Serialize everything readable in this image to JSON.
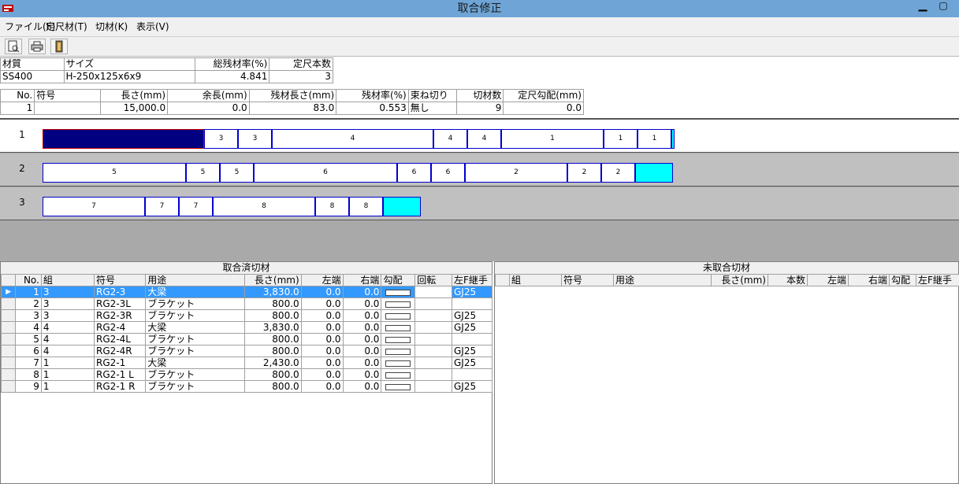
{
  "window": {
    "title": "取合修正"
  },
  "menu": [
    "ファイル(F)",
    "定尺材(T)",
    "切材(K)",
    "表示(V)"
  ],
  "summary": {
    "headers": [
      "材質",
      "サイズ",
      "総残材率(%)",
      "定尺本数"
    ],
    "values": [
      "SS400",
      "H-250x125x6x9",
      "4.841",
      "3"
    ]
  },
  "detail": {
    "headers": [
      "No.",
      "符号",
      "長さ(mm)",
      "余長(mm)",
      "残材長さ(mm)",
      "残材率(%)",
      "束ね切り",
      "切材数",
      "定尺勾配(mm)"
    ],
    "values": [
      "1",
      "",
      "15,000.0",
      "0.0",
      "83.0",
      "0.553",
      "無し",
      "9",
      "0.0"
    ]
  },
  "strips": [
    {
      "label": "1",
      "segments": [
        {
          "text": "",
          "len": 3830,
          "dark": true
        },
        {
          "text": "3",
          "len": 800
        },
        {
          "text": "3",
          "len": 800
        },
        {
          "text": "4",
          "len": 3830
        },
        {
          "text": "4",
          "len": 800
        },
        {
          "text": "4",
          "len": 800
        },
        {
          "text": "1",
          "len": 2430
        },
        {
          "text": "1",
          "len": 800
        },
        {
          "text": "1",
          "len": 800
        }
      ],
      "remainder": 83
    },
    {
      "label": "2",
      "segments": [
        {
          "text": "5",
          "len": 3400
        },
        {
          "text": "5",
          "len": 800
        },
        {
          "text": "5",
          "len": 800
        },
        {
          "text": "6",
          "len": 3400
        },
        {
          "text": "6",
          "len": 800
        },
        {
          "text": "6",
          "len": 800
        },
        {
          "text": "2",
          "len": 2430
        },
        {
          "text": "2",
          "len": 800
        },
        {
          "text": "2",
          "len": 800
        }
      ],
      "remainder": 900
    },
    {
      "label": "3",
      "segments": [
        {
          "text": "7",
          "len": 2430
        },
        {
          "text": "7",
          "len": 800
        },
        {
          "text": "7",
          "len": 800
        },
        {
          "text": "8",
          "len": 2430
        },
        {
          "text": "8",
          "len": 800
        },
        {
          "text": "8",
          "len": 800
        }
      ],
      "remainder": 900
    }
  ],
  "left_panel": {
    "caption": "取合済切材",
    "headers": [
      "No.",
      "組",
      "符号",
      "用途",
      "長さ(mm)",
      "左端",
      "右端",
      "勾配",
      "回転",
      "左F継手"
    ],
    "rows": [
      [
        "1",
        "3",
        "RG2-3",
        "大梁",
        "3,830.0",
        "0.0",
        "0.0",
        "",
        "",
        "GJ25"
      ],
      [
        "2",
        "3",
        "RG2-3L",
        "ブラケット",
        "800.0",
        "0.0",
        "0.0",
        "",
        "",
        ""
      ],
      [
        "3",
        "3",
        "RG2-3R",
        "ブラケット",
        "800.0",
        "0.0",
        "0.0",
        "",
        "",
        "GJ25"
      ],
      [
        "4",
        "4",
        "RG2-4",
        "大梁",
        "3,830.0",
        "0.0",
        "0.0",
        "",
        "",
        "GJ25"
      ],
      [
        "5",
        "4",
        "RG2-4L",
        "ブラケット",
        "800.0",
        "0.0",
        "0.0",
        "",
        "",
        ""
      ],
      [
        "6",
        "4",
        "RG2-4R",
        "ブラケット",
        "800.0",
        "0.0",
        "0.0",
        "",
        "",
        "GJ25"
      ],
      [
        "7",
        "1",
        "RG2-1",
        "大梁",
        "2,430.0",
        "0.0",
        "0.0",
        "",
        "",
        "GJ25"
      ],
      [
        "8",
        "1",
        "RG2-1 L",
        "ブラケット",
        "800.0",
        "0.0",
        "0.0",
        "",
        "",
        ""
      ],
      [
        "9",
        "1",
        "RG2-1 R",
        "ブラケット",
        "800.0",
        "0.0",
        "0.0",
        "",
        "",
        "GJ25"
      ]
    ],
    "selected_row": 0
  },
  "right_panel": {
    "caption": "未取合切材",
    "headers": [
      "組",
      "符号",
      "用途",
      "長さ(mm)",
      "本数",
      "左端",
      "右端",
      "勾配",
      "左F継手"
    ]
  }
}
